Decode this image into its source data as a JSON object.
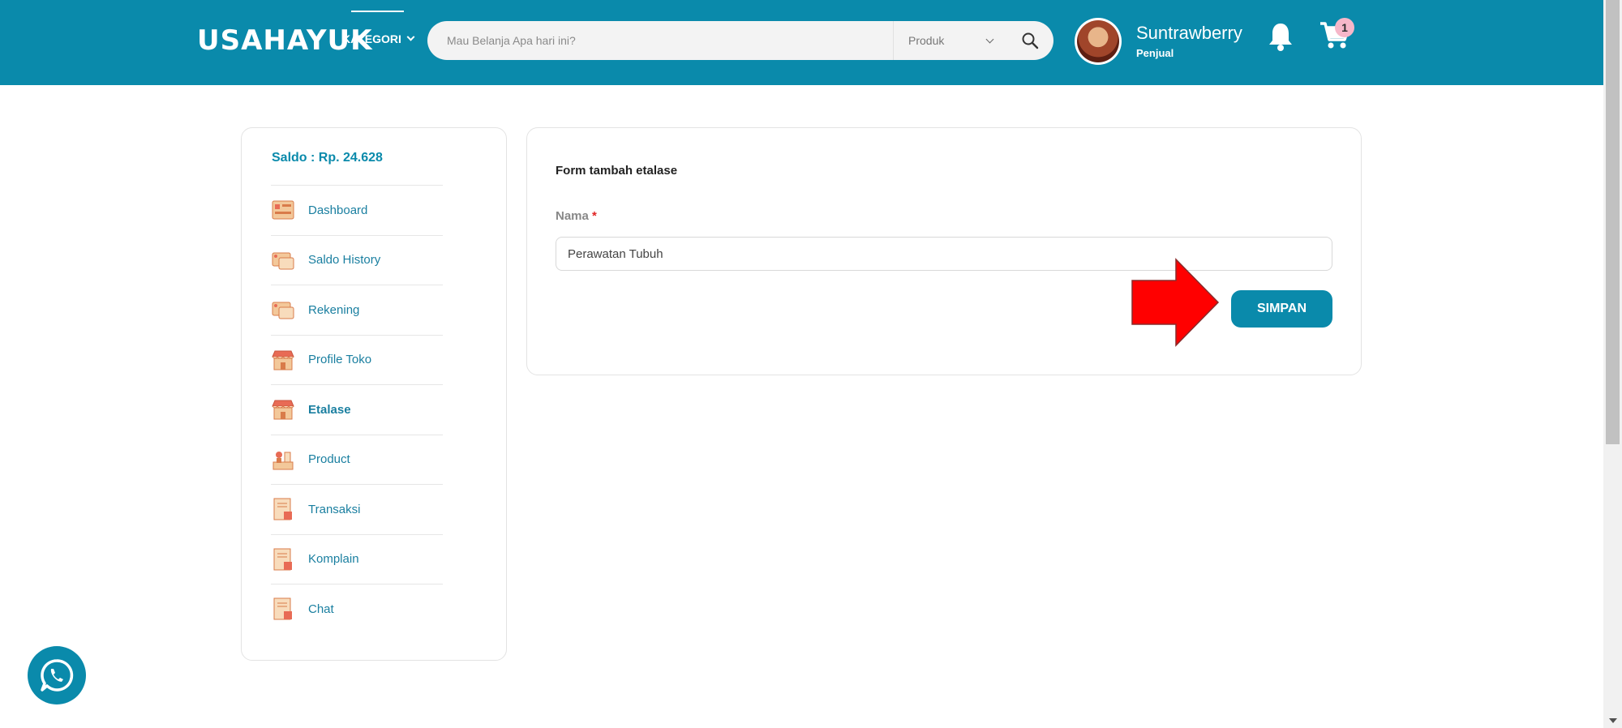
{
  "header": {
    "logo": "USAHAYUK",
    "kategori_label": "KATEGORI",
    "search_placeholder": "Mau Belanja Apa hari ini?",
    "search_type_selected": "Produk",
    "user": {
      "name": "Suntrawberry",
      "role": "Penjual"
    },
    "cart_count": "1"
  },
  "sidebar": {
    "saldo": "Saldo : Rp. 24.628",
    "items": [
      {
        "label": "Dashboard",
        "icon": "dashboard-icon"
      },
      {
        "label": "Saldo History",
        "icon": "wallet-history-icon"
      },
      {
        "label": "Rekening",
        "icon": "bank-account-icon"
      },
      {
        "label": "Profile Toko",
        "icon": "store-icon"
      },
      {
        "label": "Etalase",
        "icon": "storefront-icon"
      },
      {
        "label": "Product",
        "icon": "product-icon"
      },
      {
        "label": "Transaksi",
        "icon": "transaction-document-icon"
      },
      {
        "label": "Komplain",
        "icon": "complaint-document-icon"
      },
      {
        "label": "Chat",
        "icon": "chat-document-icon"
      }
    ],
    "active_item": "Etalase"
  },
  "form": {
    "title": "Form tambah etalase",
    "name_label": "Nama",
    "required_mark": "*",
    "name_value": "Perawatan Tubuh",
    "submit_label": "SIMPAN"
  },
  "colors": {
    "brand": "#0a8aab",
    "annotation_arrow": "#ff0000",
    "badge": "#f6b7c9"
  }
}
